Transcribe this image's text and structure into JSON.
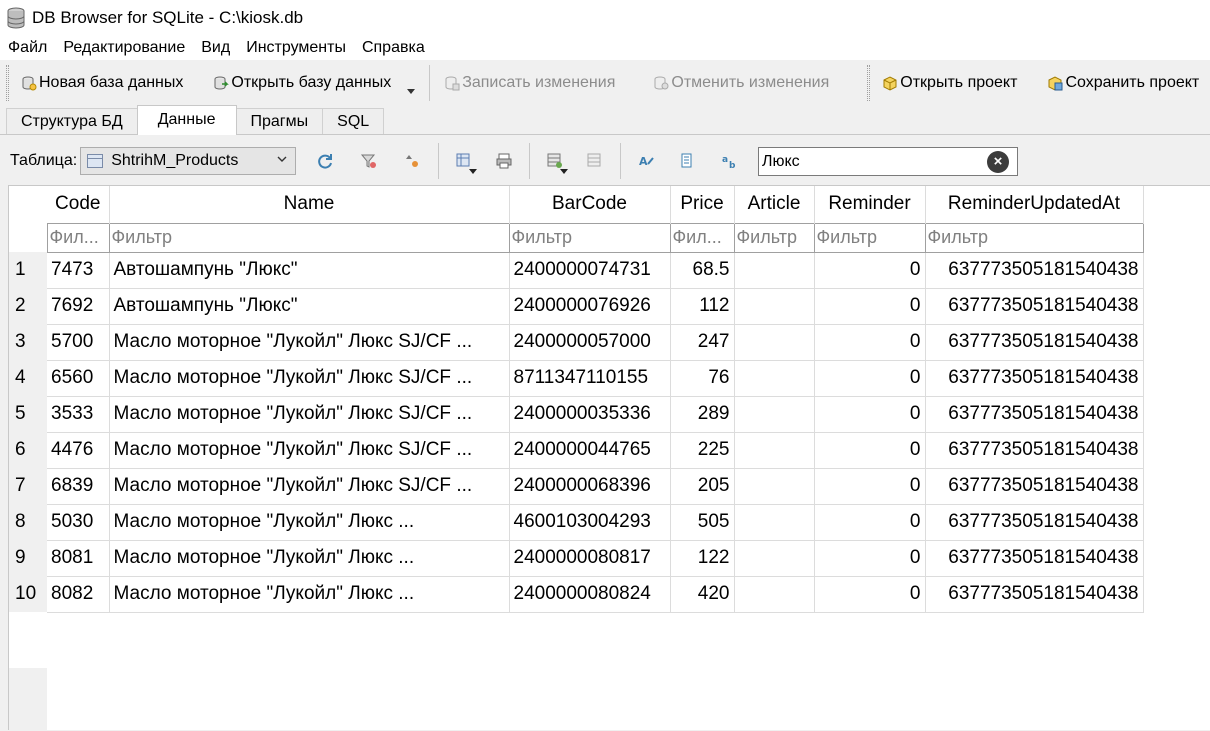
{
  "window": {
    "title": "DB Browser for SQLite - C:\\kiosk.db"
  },
  "menu": {
    "items": [
      "Файл",
      "Редактирование",
      "Вид",
      "Инструменты",
      "Справка"
    ]
  },
  "toolbar": {
    "new_db": "Новая база данных",
    "open_db": "Открыть базу данных",
    "write_changes": "Записать изменения",
    "revert_changes": "Отменить изменения",
    "open_project": "Открыть проект",
    "save_project": "Сохранить проект"
  },
  "tabs": [
    "Структура БД",
    "Данные",
    "Прагмы",
    "SQL"
  ],
  "browse": {
    "table_label": "Таблица:",
    "table_name": "ShtrihM_Products",
    "search_value": "Люкс"
  },
  "grid": {
    "columns": [
      "Code",
      "Name",
      "BarCode",
      "Price",
      "Article",
      "Reminder",
      "ReminderUpdatedAt"
    ],
    "filter_placeholders": [
      "Фил...",
      "Фильтр",
      "Фильтр",
      "Фил...",
      "Фильтр",
      "Фильтр",
      "Фильтр"
    ],
    "rows": [
      {
        "n": "1",
        "code": "7473",
        "name": "Автошампунь \"Люкс\"",
        "barcode": "2400000074731",
        "price": "68.5",
        "article": "",
        "reminder": "0",
        "updated": "637773505181540438"
      },
      {
        "n": "2",
        "code": "7692",
        "name": "Автошампунь \"Люкс\"",
        "barcode": "2400000076926",
        "price": "112",
        "article": "",
        "reminder": "0",
        "updated": "637773505181540438"
      },
      {
        "n": "3",
        "code": "5700",
        "name": "Масло моторное \"Лукойл\" Люкс  SJ/CF ...",
        "barcode": "2400000057000",
        "price": "247",
        "article": "",
        "reminder": "0",
        "updated": "637773505181540438"
      },
      {
        "n": "4",
        "code": "6560",
        "name": "Масло моторное \"Лукойл\" Люкс  SJ/CF ...",
        "barcode": "8711347110155",
        "price": "76",
        "article": "",
        "reminder": "0",
        "updated": "637773505181540438"
      },
      {
        "n": "5",
        "code": "3533",
        "name": "Масло моторное \"Лукойл\" Люкс  SJ/CF ...",
        "barcode": "2400000035336",
        "price": "289",
        "article": "",
        "reminder": "0",
        "updated": "637773505181540438"
      },
      {
        "n": "6",
        "code": "4476",
        "name": "Масло моторное \"Лукойл\" Люкс  SJ/CF ...",
        "barcode": "2400000044765",
        "price": "225",
        "article": "",
        "reminder": "0",
        "updated": "637773505181540438"
      },
      {
        "n": "7",
        "code": "6839",
        "name": "Масло моторное \"Лукойл\" Люкс  SJ/CF ...",
        "barcode": "2400000068396",
        "price": "205",
        "article": "",
        "reminder": "0",
        "updated": "637773505181540438"
      },
      {
        "n": "8",
        "code": "5030",
        "name": "Масло моторное \"Лукойл\" Люкс ...",
        "barcode": "4600103004293",
        "price": "505",
        "article": "",
        "reminder": "0",
        "updated": "637773505181540438"
      },
      {
        "n": "9",
        "code": "8081",
        "name": "Масло моторное \"Лукойл\" Люкс ...",
        "barcode": "2400000080817",
        "price": "122",
        "article": "",
        "reminder": "0",
        "updated": "637773505181540438"
      },
      {
        "n": "10",
        "code": "8082",
        "name": "Масло моторное \"Лукойл\" Люкс ...",
        "barcode": "2400000080824",
        "price": "420",
        "article": "",
        "reminder": "0",
        "updated": "637773505181540438"
      }
    ]
  },
  "icons": {
    "app": "database-icon",
    "new_db": "new-database-icon",
    "open_db": "open-database-icon",
    "write": "write-changes-icon",
    "revert": "revert-changes-icon",
    "open_project": "open-project-icon",
    "save_project": "save-project-icon"
  },
  "colors": {
    "accent": "#3c7fb1",
    "disabled_text": "#8c8c8c",
    "placeholder": "#808080"
  }
}
